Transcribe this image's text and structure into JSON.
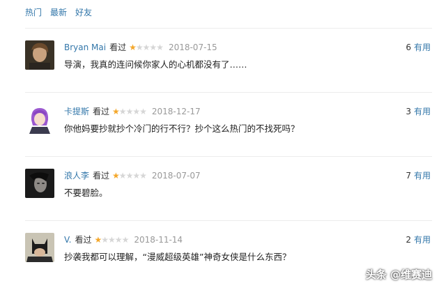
{
  "tabs": [
    {
      "label": "热门"
    },
    {
      "label": "最新"
    },
    {
      "label": "好友"
    }
  ],
  "comments": [
    {
      "user": "Bryan Mai",
      "seen": "看过",
      "rating": 1,
      "date": "2018-07-15",
      "text": "导演，我真的连问候你家人的心机都没有了……",
      "votes": "6",
      "useful": "有用",
      "avatar_icon": "portrait-male-avatar"
    },
    {
      "user": "卡提斯",
      "seen": "看过",
      "rating": 1,
      "date": "2018-12-17",
      "text": "你他妈要抄就抄个冷门的行不行？抄个这么热门的不找死吗？",
      "votes": "3",
      "useful": "有用",
      "avatar_icon": "anime-girl-avatar"
    },
    {
      "user": "浪人李",
      "seen": "看过",
      "rating": 1,
      "date": "2018-07-07",
      "text": "不要碧脸。",
      "votes": "7",
      "useful": "有用",
      "avatar_icon": "dark-face-avatar"
    },
    {
      "user": "V.",
      "seen": "看过",
      "rating": 1,
      "date": "2018-11-14",
      "text": "抄袭我都可以理解，“漫威超级英雄”神奇女侠是什么东西？",
      "votes": "2",
      "useful": "有用",
      "avatar_icon": "batman-avatar"
    }
  ],
  "watermark": "头条 @维赛迪",
  "colors": {
    "link": "#3377aa",
    "star_on": "#f4a72a",
    "star_off": "#d6d6d6",
    "date": "#999999"
  }
}
